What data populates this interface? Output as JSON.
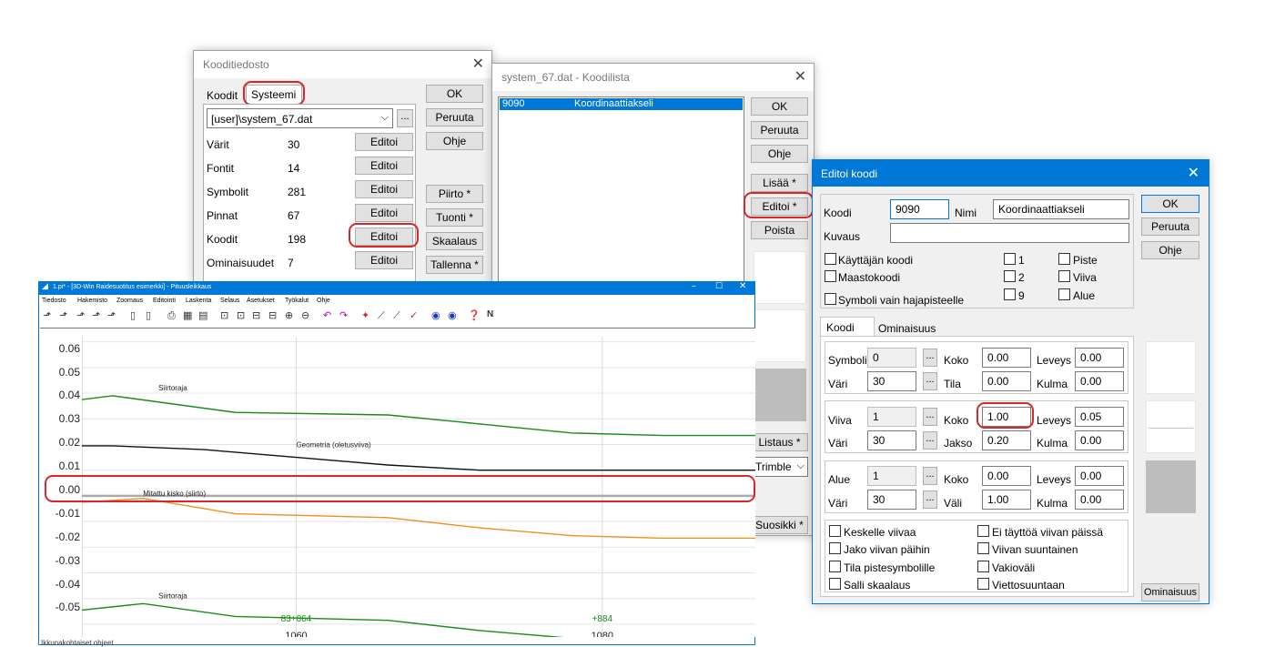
{
  "kooditiedosto": {
    "title": "Kooditiedosto",
    "tabs": [
      "Koodit",
      "Systeemi"
    ],
    "file_select": "[user]\\system_67.dat",
    "browse": "...",
    "rows": [
      {
        "label": "Värit",
        "count": "30",
        "button": "Editoi"
      },
      {
        "label": "Fontit",
        "count": "14",
        "button": "Editoi"
      },
      {
        "label": "Symbolit",
        "count": "281",
        "button": "Editoi"
      },
      {
        "label": "Pinnat",
        "count": "67",
        "button": "Editoi"
      },
      {
        "label": "Koodit",
        "count": "198",
        "button": "Editoi"
      },
      {
        "label": "Ominaisuudet",
        "count": "7",
        "button": "Editoi"
      }
    ],
    "buttons": [
      "OK",
      "Peruuta",
      "Ohje",
      "Piirto *",
      "Tuonti *",
      "Skaalaus",
      "Tallenna *"
    ]
  },
  "koodilista": {
    "title": "system_67.dat - Koodilista",
    "selected_code": "9090",
    "selected_name": "Koordinaattiakseli",
    "buttons": [
      "OK",
      "Peruuta",
      "Ohje",
      "Lisää *",
      "Editoi *",
      "Poista"
    ],
    "lower_buttons": [
      "Listaus *",
      "Trimble",
      "Suosikki *"
    ]
  },
  "editoi": {
    "title": "Editoi koodi",
    "koodi_label": "Koodi",
    "koodi_value": "9090",
    "nimi_label": "Nimi",
    "nimi_value": "Koordinaattiakseli",
    "kuvaus_label": "Kuvaus",
    "kuvaus_value": "",
    "buttons": [
      "OK",
      "Peruuta",
      "Ohje"
    ],
    "checks_left": [
      "Käyttäjän koodi",
      "Maastokoodi",
      "Symboli vain hajapisteelle"
    ],
    "checks_mid": [
      "1",
      "2",
      "9"
    ],
    "checks_right": [
      "Piste",
      "Viiva",
      "Alue"
    ],
    "tabs": [
      "Koodi",
      "Ominaisuus"
    ],
    "symboli": {
      "label": "Symboli",
      "value": "0",
      "koko": "0.00",
      "leveys": "0.00",
      "vari": "30",
      "tila": "0.00",
      "kulma": "0.00"
    },
    "viiva": {
      "label": "Viiva",
      "value": "1",
      "koko": "1.00",
      "leveys": "0.05",
      "vari": "30",
      "jakso": "0.20",
      "kulma": "0.00"
    },
    "alue": {
      "label": "Alue",
      "value": "1",
      "koko": "0.00",
      "leveys": "0.00",
      "vari": "30",
      "vali": "1.00",
      "kulma": "0.00"
    },
    "field_labels": {
      "koko": "Koko",
      "leveys": "Leveys",
      "vari": "Väri",
      "tila": "Tila",
      "kulma": "Kulma",
      "jakso": "Jakso",
      "vali": "Väli"
    },
    "bottom_checks_left": [
      "Keskelle viivaa",
      "Jako viivan päihin",
      "Tila pistesymbolille",
      "Salli skaalaus"
    ],
    "bottom_checks_right": [
      "Ei täyttöä viivan päissä",
      "Viivan suuntainen",
      "Vakioväli",
      "Viettosuuntaan"
    ],
    "ominaisuus_button": "Ominaisuus"
  },
  "mainwin": {
    "title": "1.pi* - [3D-Win Raidesuotitus esimerkki] - Pituusleikkaus",
    "menu": [
      "Tiedosto",
      "Hakemisto",
      "Zoomaus",
      "Editointi",
      "Laskenta",
      "Selaus",
      "Asetukset",
      "Työkalut",
      "Ohje"
    ],
    "status": "Ikkunakohtaiset ohjeet",
    "toolbar_n": "N"
  },
  "chart_data": {
    "type": "line",
    "y_ticks": [
      "0.06",
      "0.05",
      "0.04",
      "0.03",
      "0.02",
      "0.01",
      "0.00",
      "-0.01",
      "-0.02",
      "-0.03",
      "-0.04",
      "-0.05"
    ],
    "ylim": [
      -0.055,
      0.062
    ],
    "xlim": [
      1046,
      1090
    ],
    "x_ticks": [
      {
        "x": 1060,
        "label": "1060"
      },
      {
        "x": 1080,
        "label": "1080"
      }
    ],
    "annotations": [
      {
        "text": "Siirtoraja",
        "x": 1051,
        "y": 0.041
      },
      {
        "text": "Geometria (oletusviiva)",
        "x": 1060,
        "y": 0.019
      },
      {
        "text": "Mitattu kisko (siirto)",
        "x": 1050,
        "y": 0.0
      },
      {
        "text": "Siirtoraja",
        "x": 1051,
        "y": -0.04
      },
      {
        "text": "83+864",
        "x": 1060,
        "y": -0.049
      },
      {
        "text": "+884",
        "x": 1080,
        "y": -0.049
      }
    ],
    "series": [
      {
        "color": "#1a8a1a",
        "x": [
          1046,
          1048,
          1056,
          1066,
          1072,
          1078,
          1084,
          1090
        ],
        "y": [
          0.0375,
          0.039,
          0.0325,
          0.0315,
          0.028,
          0.0245,
          0.0235,
          0.0235
        ]
      },
      {
        "color": "#111111",
        "x": [
          1046,
          1048,
          1054,
          1060,
          1066,
          1072,
          1078,
          1090
        ],
        "y": [
          0.0195,
          0.0195,
          0.018,
          0.015,
          0.012,
          0.01,
          0.01,
          0.01
        ]
      },
      {
        "color": "#aaaaaa",
        "x": [
          1046,
          1090
        ],
        "y": [
          0.0,
          0.0
        ]
      },
      {
        "color": "#f0901a",
        "x": [
          1046,
          1050,
          1056,
          1066,
          1072,
          1078,
          1084,
          1090
        ],
        "y": [
          -0.0025,
          -0.001,
          -0.007,
          -0.0085,
          -0.0125,
          -0.0155,
          -0.0165,
          -0.0165
        ]
      },
      {
        "color": "#1a8a1a",
        "x": [
          1046,
          1050,
          1056,
          1066,
          1072,
          1078,
          1084,
          1090
        ],
        "y": [
          -0.0445,
          -0.042,
          -0.047,
          -0.0485,
          -0.0525,
          -0.0555,
          -0.0565,
          -0.0565
        ]
      }
    ]
  }
}
